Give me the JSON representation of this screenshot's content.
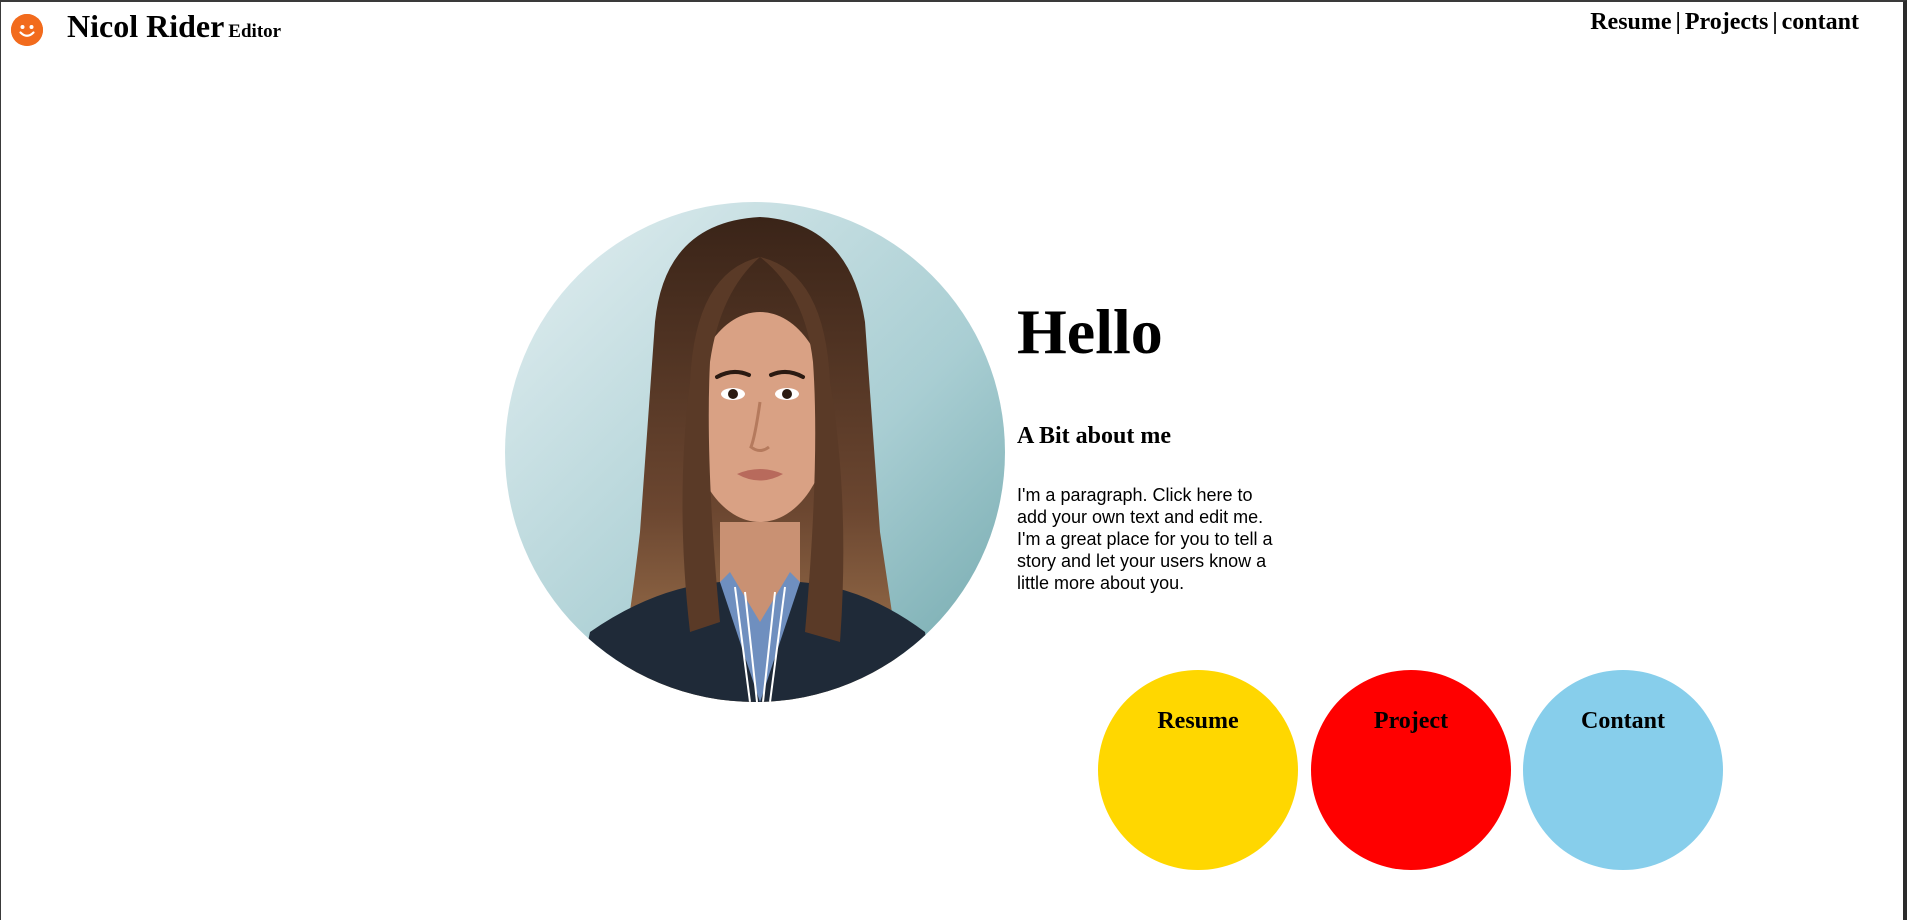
{
  "header": {
    "name": "Nicol Rider",
    "role": "Editor",
    "logo_icon": "smiley-icon",
    "logo_color": "#f26b1d"
  },
  "nav": {
    "resume": "Resume",
    "projects": "Projects",
    "contact": "contant",
    "separator": "|"
  },
  "hero": {
    "portrait_icon": "profile-photo",
    "greeting": "Hello",
    "subheading": "A Bit about me",
    "paragraph": "I'm a paragraph. Click here to add your own text and edit me. I'm a great place for you to tell a story and let your users know a little more about you."
  },
  "cards": [
    {
      "label": "Resume",
      "color": "#ffd700"
    },
    {
      "label": "Project",
      "color": "#ff0000"
    },
    {
      "label": "Contant",
      "color": "#87ceeb"
    }
  ]
}
